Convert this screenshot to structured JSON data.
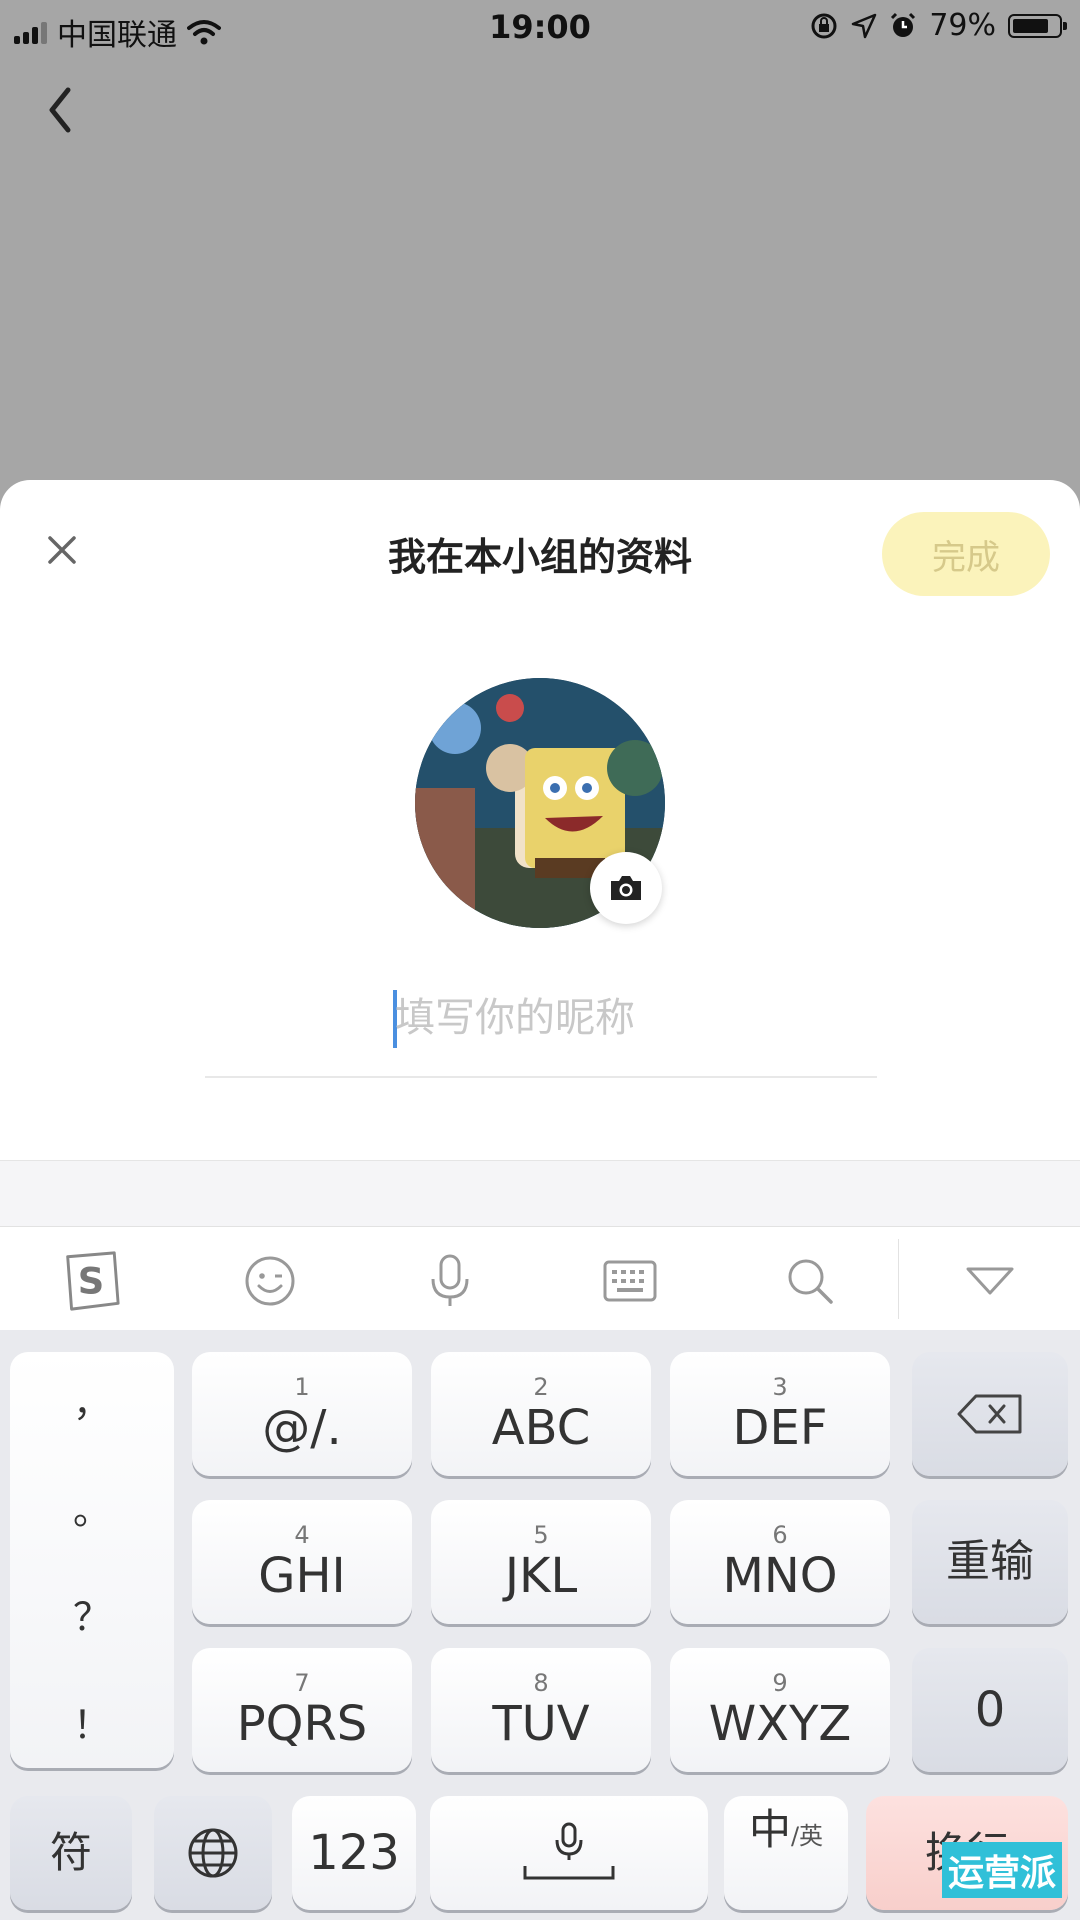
{
  "status_bar": {
    "carrier": "中国联通",
    "time": "19:00",
    "battery": "79%",
    "battery_level": 0.79
  },
  "sheet": {
    "title": "我在本小组的资料",
    "done_label": "完成",
    "nickname_placeholder": "填写你的昵称"
  },
  "keyboard": {
    "toolbar": [
      "sogou-logo-icon",
      "emoji-icon",
      "microphone-icon",
      "keyboard-icon",
      "search-icon",
      "collapse-icon"
    ],
    "punctuation": [
      "，",
      "。",
      "？",
      "！"
    ],
    "rows": [
      [
        {
          "num": "1",
          "label": "@/."
        },
        {
          "num": "2",
          "label": "ABC"
        },
        {
          "num": "3",
          "label": "DEF"
        }
      ],
      [
        {
          "num": "4",
          "label": "GHI"
        },
        {
          "num": "5",
          "label": "JKL"
        },
        {
          "num": "6",
          "label": "MNO"
        }
      ],
      [
        {
          "num": "7",
          "label": "PQRS"
        },
        {
          "num": "8",
          "label": "TUV"
        },
        {
          "num": "9",
          "label": "WXYZ"
        }
      ]
    ],
    "reenter_label": "重输",
    "zero_label": "0",
    "symbols_label": "符",
    "num_label": "123",
    "lang_main": "中",
    "lang_sub": "/英",
    "enter_label": "换行"
  },
  "watermark": "运营派",
  "colors": {
    "done_bg": "#fbf3bb",
    "overlay": "#a6a6a6",
    "caret": "#4a8fe0"
  }
}
